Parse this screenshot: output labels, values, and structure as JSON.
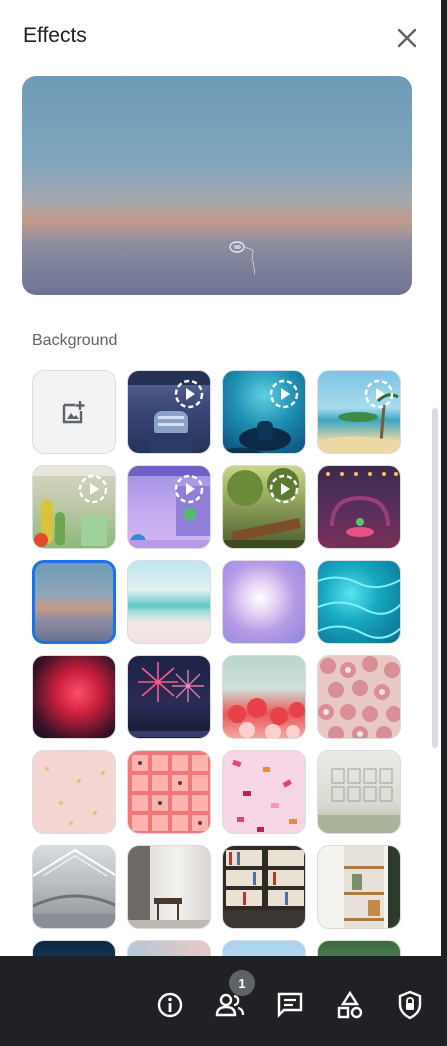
{
  "header": {
    "title": "Effects"
  },
  "section": {
    "label": "Background"
  },
  "bottom_bar": {
    "participants_count": "1"
  },
  "backgrounds": [
    {
      "name": "upload-background",
      "kind": "add"
    },
    {
      "name": "classroom-chairs-animated",
      "animated": true
    },
    {
      "name": "underwater-animated",
      "animated": true
    },
    {
      "name": "beach-island-animated",
      "animated": true
    },
    {
      "name": "cactus-garden-animated",
      "animated": true
    },
    {
      "name": "purple-window-animated",
      "animated": true
    },
    {
      "name": "forest-log-animated",
      "animated": true
    },
    {
      "name": "pink-lounge",
      "animated": false
    },
    {
      "name": "sunset-gradient",
      "animated": false,
      "selected": true
    },
    {
      "name": "beach-sky",
      "animated": false
    },
    {
      "name": "pastel-clouds",
      "animated": false
    },
    {
      "name": "teal-water",
      "animated": false
    },
    {
      "name": "galaxy-nebula",
      "animated": false
    },
    {
      "name": "fireworks",
      "animated": false
    },
    {
      "name": "red-flowers",
      "animated": false
    },
    {
      "name": "pink-roses-wall",
      "animated": false
    },
    {
      "name": "pink-confetti",
      "animated": false
    },
    {
      "name": "pink-grid-pattern",
      "animated": false
    },
    {
      "name": "petal-confetti",
      "animated": false
    },
    {
      "name": "white-room-frames",
      "animated": false
    },
    {
      "name": "glass-ceiling-office",
      "animated": false
    },
    {
      "name": "sunlit-room-chair",
      "animated": false
    },
    {
      "name": "bookshelf",
      "animated": false
    },
    {
      "name": "shelf-corner",
      "animated": false
    }
  ],
  "colors": {
    "accent": "#1a73e8",
    "panel_bg": "#ffffff",
    "bar_bg": "#202124"
  }
}
